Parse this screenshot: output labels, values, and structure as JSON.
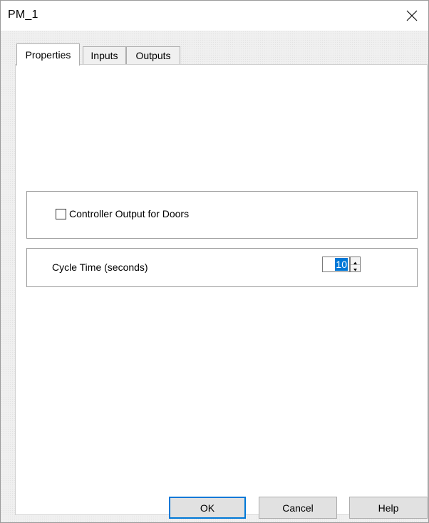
{
  "window": {
    "title": "PM_1",
    "close_icon": "close-icon"
  },
  "tabs": [
    {
      "label": "Properties",
      "active": true
    },
    {
      "label": "Inputs",
      "active": false
    },
    {
      "label": "Outputs",
      "active": false
    }
  ],
  "properties": {
    "controller_output": {
      "label": "Controller Output for Doors",
      "checked": false
    },
    "cycle_time": {
      "label": "Cycle Time (seconds)",
      "value": "10"
    }
  },
  "buttons": {
    "ok": "OK",
    "cancel": "Cancel",
    "help": "Help"
  },
  "colors": {
    "accent": "#0078d7",
    "panel": "#ffffff",
    "dialog_background": "#f0f0f0"
  }
}
